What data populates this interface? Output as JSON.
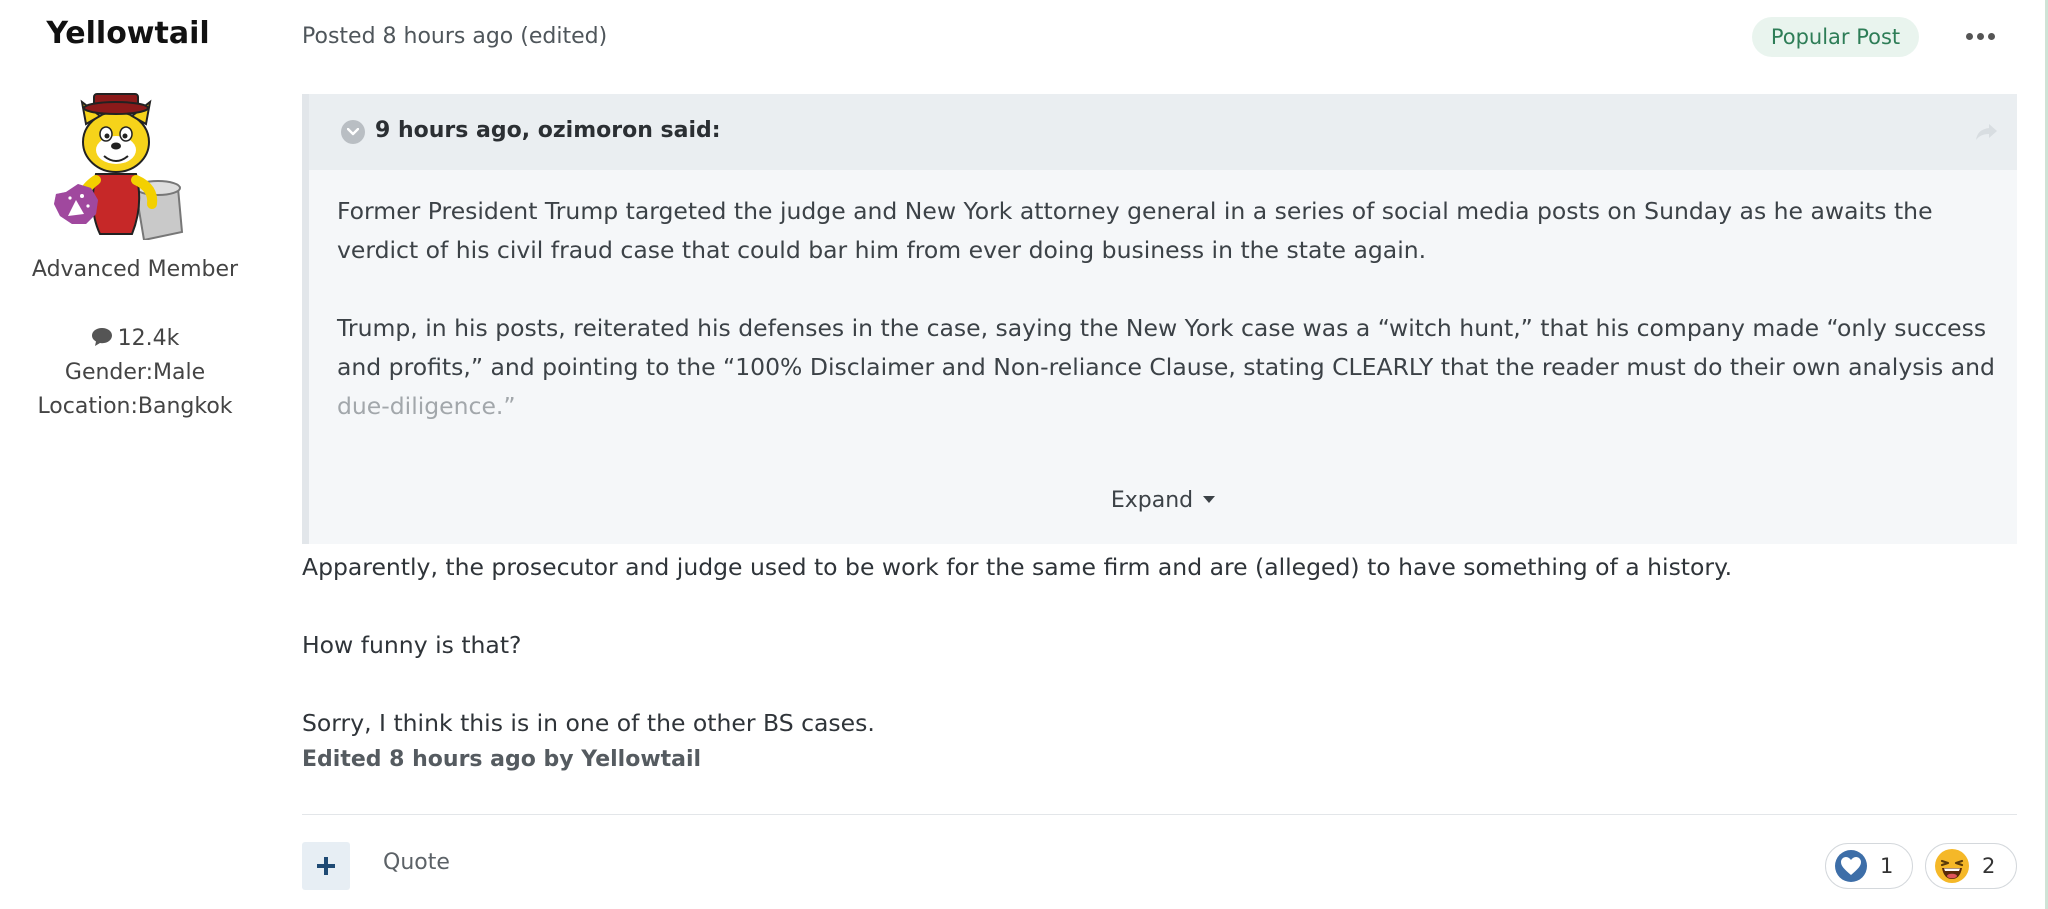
{
  "author": {
    "name": "Yellowtail",
    "rank": "Advanced Member",
    "posts": "12.4k",
    "gender": "Gender:Male",
    "location": "Location:Bangkok"
  },
  "post": {
    "posted": "Posted 8 hours ago (edited)",
    "badge": "Popular Post",
    "quote": {
      "citation": "9 hours ago, ozimoron said:",
      "paragraph1": "Former President Trump targeted the judge and New York attorney general in a series of social media posts on Sunday as he awaits the verdict of his civil fraud case that could bar him from ever doing business in the state again.",
      "paragraph2": "Trump, in his posts, reiterated his defenses in the case, saying the New York case was a “witch hunt,” that his company made “only success and profits,” and pointing to the “100% Disclaimer and Non-reliance Clause, stating CLEARLY that the reader must do their own analysis and ",
      "paragraph2_faded": "due-diligence.”",
      "expand_label": "Expand"
    },
    "body": [
      "Apparently, the prosecutor and judge used to be work for the same firm and are (alleged) to have something of a history.",
      "How funny is that?",
      "Sorry, I think this is in one of the other BS cases."
    ],
    "edited_note": "Edited 8 hours ago by Yellowtail"
  },
  "footer": {
    "add_label": "+",
    "quote_label": "Quote",
    "reactions": [
      {
        "icon": "like-heart-icon",
        "count": "1"
      },
      {
        "icon": "haha-emoji-icon",
        "count": "2"
      }
    ]
  },
  "colors": {
    "badge_bg": "#e9f4ee",
    "badge_text": "#2e7d57",
    "quote_bg": "#f5f7f9",
    "like_blue": "#3d6ea8",
    "haha_yellow": "#f5b828"
  }
}
